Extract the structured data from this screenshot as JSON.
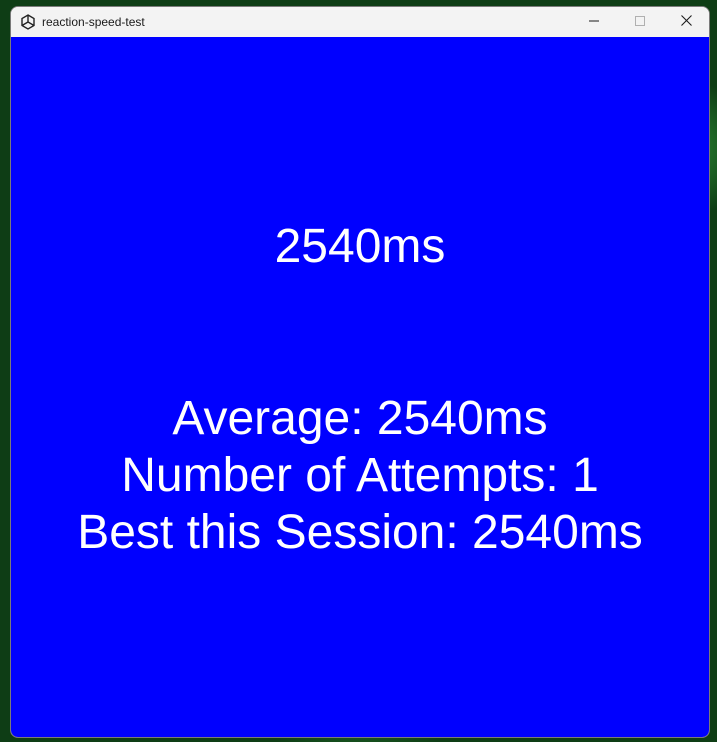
{
  "window": {
    "title": "reaction-speed-test",
    "app_icon": "unity-icon",
    "controls": [
      "minimize-icon",
      "maximize-icon",
      "close-icon"
    ]
  },
  "game": {
    "background_color": "#0000ff",
    "text_color": "#ffffff",
    "last_time": "2540ms",
    "average": "Average: 2540ms",
    "attempts": "Number of Attempts: 1",
    "best": "Best this Session: 2540ms"
  }
}
